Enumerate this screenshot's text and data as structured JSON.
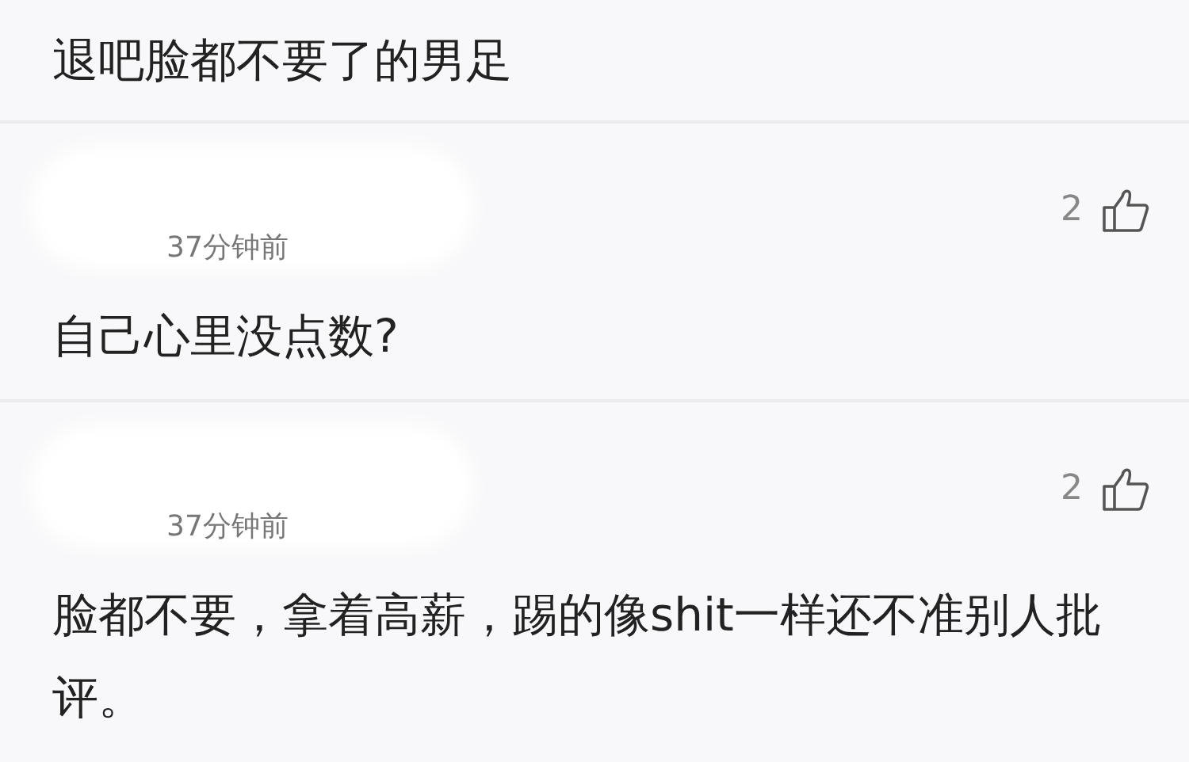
{
  "comments": [
    {
      "text": "退吧脸都不要了的男足"
    },
    {
      "time": "37分钟前",
      "likes": "2",
      "text": "自己心里没点数?"
    },
    {
      "time": "37分钟前",
      "likes": "2",
      "text": "脸都不要，拿着高薪，踢的像shit一样还不准别人批评。"
    }
  ]
}
